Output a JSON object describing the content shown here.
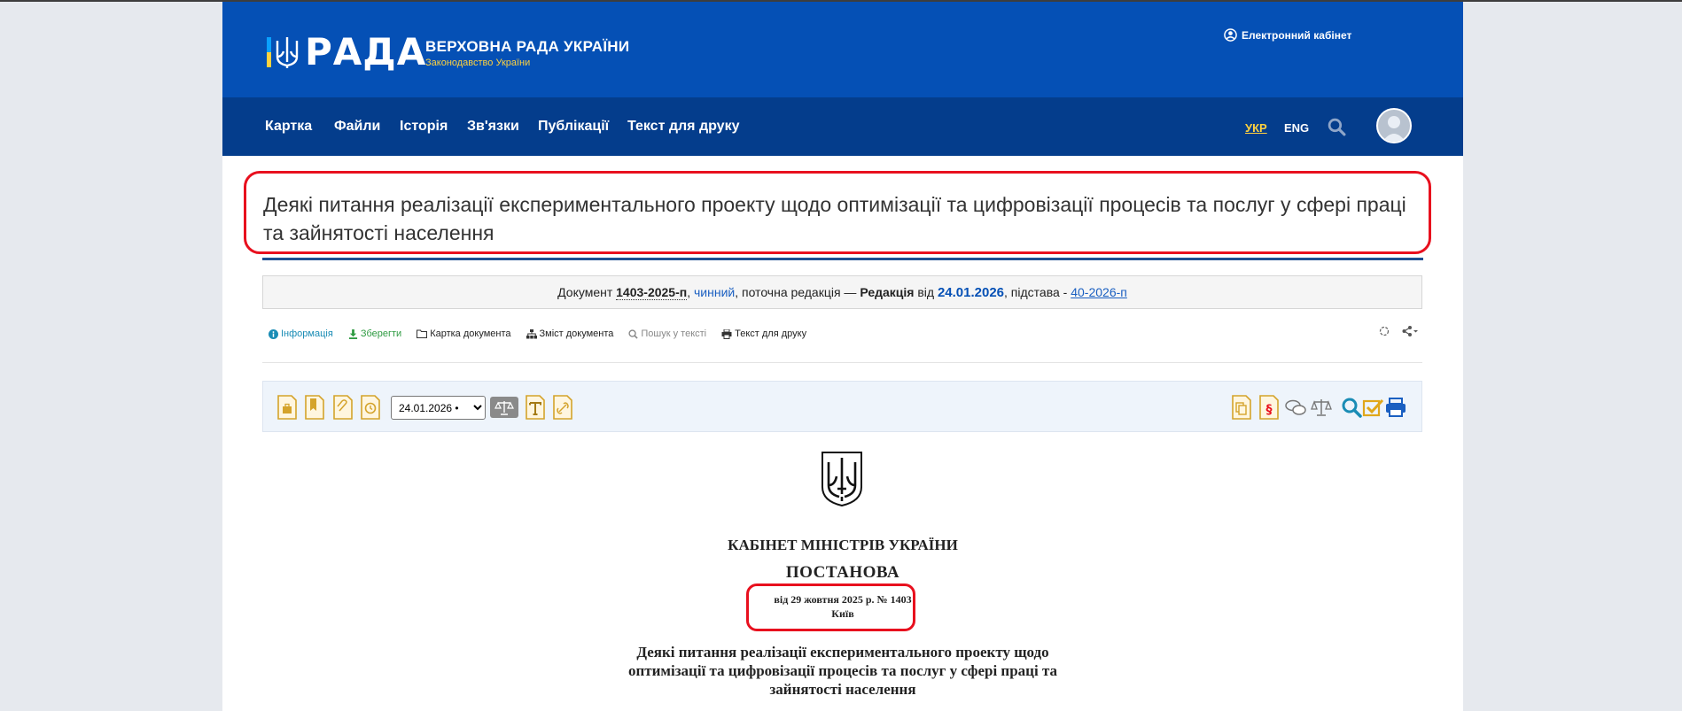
{
  "header": {
    "logo_text": "РАДА",
    "org_name": "ВЕРХОВНА РАДА УКРАЇНИ",
    "org_sub": "Законодавство України",
    "cabinet_label": "Електронний кабінет"
  },
  "nav": {
    "items": [
      "Картка",
      "Файли",
      "Історія",
      "Зв'язки",
      "Публікації",
      "Текст для друку"
    ],
    "lang_ukr": "УКР",
    "lang_eng": "ENG"
  },
  "document": {
    "title": "Деякі питання реалізації експериментального проекту щодо оптимізації та цифровізації процесів та послуг у сфері праці та зайнятості населення",
    "status": {
      "prefix": "Документ ",
      "number": "1403-2025-п",
      "sep1": ", ",
      "state": "чинний",
      "middle": ", поточна редакція — ",
      "edition_label": "Редакція",
      "from": " від ",
      "edition_date": "24.01.2026",
      "basis_prefix": ", підстава - ",
      "basis_link": "40-2026-п"
    }
  },
  "tools": {
    "info": "Інформація",
    "save": "Зберегти",
    "card": "Картка документа",
    "contents": "Зміст документа",
    "search": "Пошук у тексті",
    "print": "Текст для друку"
  },
  "toolbar": {
    "date_value": "24.01.2026 •"
  },
  "content": {
    "org": "КАБІНЕТ МІНІСТРІВ УКРАЇНИ",
    "type": "ПОСТАНОВА",
    "date_line": "від 29 жовтня 2025 р. № 1403",
    "city": "Київ",
    "subtitle": "Деякі питання реалізації експериментального проекту щодо оптимізації та цифровізації процесів та послуг у сфері праці та зайнятості населення"
  },
  "colors": {
    "header_blue": "#0550b5",
    "nav_blue": "#043d8c",
    "accent_yellow": "#ffd23f",
    "highlight_red": "#e8101e"
  },
  "icons": [
    "trident-icon",
    "user-circle-icon",
    "search-icon",
    "avatar-icon",
    "info-icon",
    "download-icon",
    "folder-icon",
    "sitemap-icon",
    "print-icon",
    "spinner-icon",
    "share-icon"
  ]
}
